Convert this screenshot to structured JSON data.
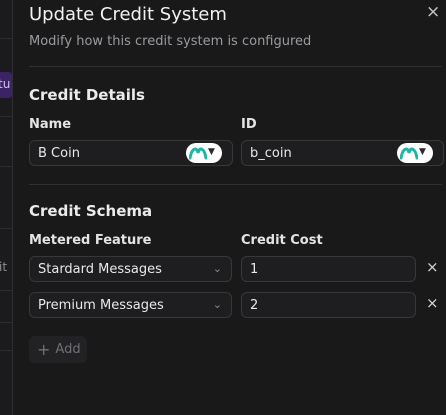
{
  "background": {
    "fragment_top": "tu",
    "fragment_mid": "it"
  },
  "dialog": {
    "title": "Update Credit System",
    "subtitle": "Modify how this credit system is configured",
    "close_icon": "×"
  },
  "credit_details": {
    "heading": "Credit Details",
    "name_label": "Name",
    "name_value": "B Coin",
    "id_label": "ID",
    "id_value": "b_coin"
  },
  "credit_schema": {
    "heading": "Credit Schema",
    "feature_label": "Metered Feature",
    "cost_label": "Credit Cost",
    "rows": [
      {
        "feature": "Stardard Messages",
        "cost": "1"
      },
      {
        "feature": "Premium Messages",
        "cost": "2"
      }
    ],
    "add_label": "Add"
  },
  "colors": {
    "accent_icon": "#1fb5a3",
    "dialog_bg": "#19191a",
    "field_bg": "#1e1e20"
  },
  "icons": [
    "close-icon",
    "chevron-down-icon",
    "teal-arc-icon",
    "plus-icon"
  ]
}
